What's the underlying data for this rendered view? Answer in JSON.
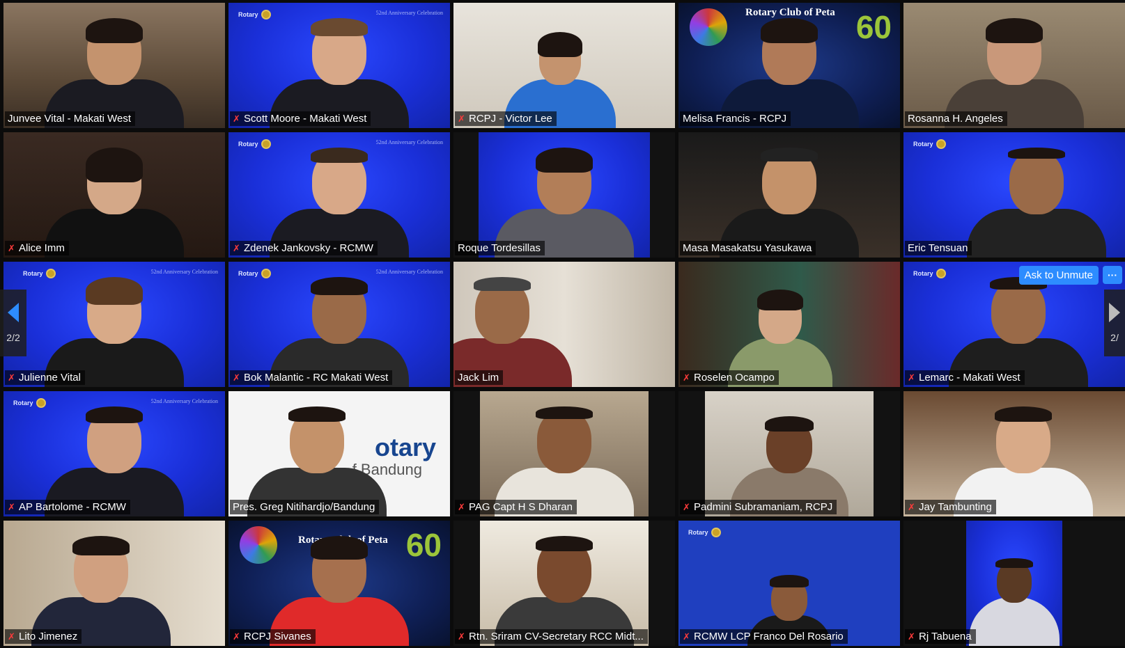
{
  "controls": {
    "ask_to_unmute": "Ask to Unmute",
    "more": "···",
    "page_indicator_left": "2/2",
    "page_indicator_right": "2/"
  },
  "participants": [
    {
      "name": "Junvee Vital - Makati West",
      "muted": false
    },
    {
      "name": "Scott Moore - Makati West",
      "muted": true
    },
    {
      "name": "RCPJ - Victor Lee",
      "muted": true
    },
    {
      "name": "Melisa Francis - RCPJ",
      "muted": false
    },
    {
      "name": "Rosanna H. Angeles",
      "muted": false
    },
    {
      "name": "Alice Imm",
      "muted": true
    },
    {
      "name": "Zdenek Jankovsky - RCMW",
      "muted": true
    },
    {
      "name": "Roque Tordesillas",
      "muted": false
    },
    {
      "name": "Masa Masakatsu Yasukawa",
      "muted": false
    },
    {
      "name": "Eric Tensuan",
      "muted": false
    },
    {
      "name": "Julienne Vital",
      "muted": true
    },
    {
      "name": "Bok Malantic - RC Makati West",
      "muted": true
    },
    {
      "name": "Jack Lim",
      "muted": false
    },
    {
      "name": "Roselen Ocampo",
      "muted": true
    },
    {
      "name": "Lemarc - Makati West",
      "muted": true
    },
    {
      "name": "AP Bartolome - RCMW",
      "muted": true
    },
    {
      "name": "Pres. Greg Nitihardjo/Bandung",
      "muted": false
    },
    {
      "name": "PAG Capt H S Dharan",
      "muted": true
    },
    {
      "name": "Padmini Subramaniam, RCPJ",
      "muted": true
    },
    {
      "name": "Jay Tambunting",
      "muted": true
    },
    {
      "name": "Lito Jimenez",
      "muted": true
    },
    {
      "name": "RCPJ Sivanes",
      "muted": true
    },
    {
      "name": "Rtn. Sriram CV-Secretary RCC Midt...",
      "muted": true
    },
    {
      "name": "RCMW LCP Franco Del Rosario",
      "muted": true
    },
    {
      "name": "Rj Tabuena",
      "muted": true
    }
  ],
  "backgrounds": {
    "rotary_label": "Rotary",
    "anniversary_label": "52nd Anniversary Celebration",
    "club_label": "Rotary Club of Peta",
    "sixty": "60",
    "bandung_logo": "otary",
    "bandung_sub": "f Bandung"
  },
  "colors": {
    "accent_blue": "#2d8cff",
    "mute_red": "#ff3b3b",
    "rotary_blue": "#1a2fd8"
  }
}
